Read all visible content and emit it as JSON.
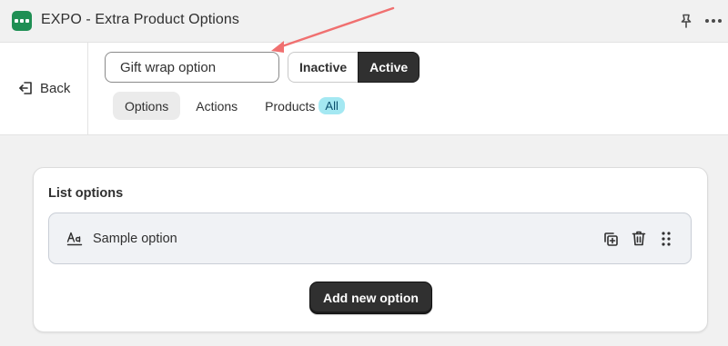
{
  "app": {
    "title": "EXPO - Extra Product Options",
    "logo_icon": "app-logo-icon",
    "brand_color": "#1f8f54"
  },
  "titlebar": {
    "pin_icon": "pin-icon",
    "more_icon": "more-horizontal-icon"
  },
  "header": {
    "back_label": "Back",
    "option_name_value": "Gift wrap option",
    "status": {
      "options": [
        "Inactive",
        "Active"
      ],
      "selected": "Active"
    },
    "tabs": [
      {
        "label": "Options",
        "selected": true
      },
      {
        "label": "Actions",
        "selected": false
      },
      {
        "label": "Products",
        "selected": false,
        "badge": "All"
      }
    ]
  },
  "card": {
    "title": "List options",
    "options": [
      {
        "label": "Sample option",
        "icon": "text-format-icon"
      }
    ],
    "add_button_label": "Add new option"
  },
  "annotation": {
    "arrow_color": "#f07070"
  }
}
